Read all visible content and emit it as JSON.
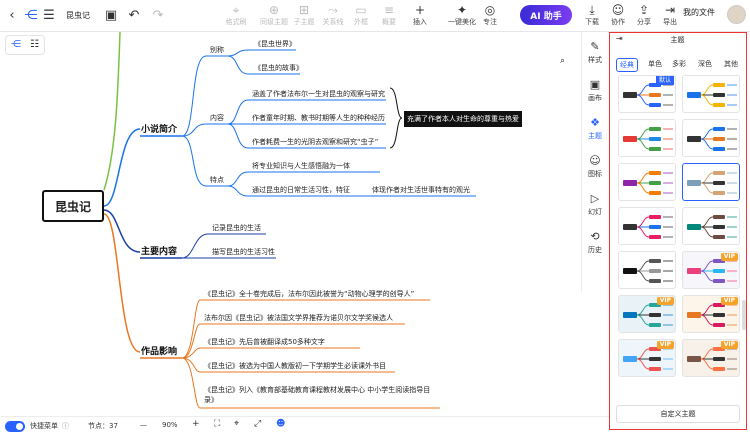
{
  "topbar": {
    "doc_title": "昆虫记",
    "tools": [
      {
        "glyph": "⌖",
        "label": "格式刷"
      },
      {
        "glyph": "⊕",
        "label": "同级主题"
      },
      {
        "glyph": "⊞",
        "label": "子主题"
      },
      {
        "glyph": "⤳",
        "label": "关系线"
      },
      {
        "glyph": "▭",
        "label": "外框"
      },
      {
        "glyph": "≡",
        "label": "概要"
      },
      {
        "glyph": "+",
        "label": "插入"
      },
      {
        "glyph": "✦",
        "label": "一键美化"
      },
      {
        "glyph": "◎",
        "label": "专注"
      }
    ],
    "ai_label": "AI 助手",
    "right_tools": [
      {
        "glyph": "⤓",
        "label": "下载"
      },
      {
        "glyph": "☺",
        "label": "协作"
      },
      {
        "glyph": "⇪",
        "label": "分享"
      },
      {
        "glyph": "⇥",
        "label": "导出"
      }
    ],
    "my_files": "我的文件"
  },
  "mindmap": {
    "root": "昆虫记",
    "branches": [
      {
        "title": "小说简介",
        "color": "#1a73e8",
        "groups": [
          {
            "label": "别称",
            "items": [
              "《昆虫世界》",
              "《昆虫的故事》"
            ]
          },
          {
            "label": "内容",
            "items": [
              "涵盖了作者法布尔一生对昆虫的观察与研究",
              "作者童年时期、教书时期等人生的种种经历",
              "作者耗费一生的光阴去观察和研究“虫子”"
            ]
          },
          {
            "label": "特点",
            "items": [
              "将专业知识与人生感悟融为一体",
              "通过昆虫的日常生活习性，特征"
            ]
          }
        ],
        "callout": "充满了作者本人对生命的尊重与热爱",
        "extra": "体现作者对生活世事特有的观光"
      },
      {
        "title": "主要内容",
        "color": "#1a3fa8",
        "items": [
          "记录昆虫的生活",
          "描写昆虫的生活习性"
        ]
      },
      {
        "title": "作品影响",
        "color": "#e87722",
        "items": [
          "《昆虫记》全十卷完成后，法布尔因此被誉为“动物心理学的创导人”",
          "法布尔因《昆虫记》被法国文学界推荐为诺贝尔文学奖候选人",
          "《昆虫记》先后曾被翻译成50多种文字",
          "《昆虫记》被选为中国人教版初一下学期学生必读课外书目",
          "《昆虫记》列入《教育部基础教育课程教材发展中心 中小学生阅读指导目",
          "录》"
        ]
      }
    ]
  },
  "rail": {
    "items": [
      {
        "glyph": "✎",
        "label": "样式"
      },
      {
        "glyph": "▣",
        "label": "画布"
      },
      {
        "glyph": "❖",
        "label": "主题"
      },
      {
        "glyph": "☺",
        "label": "图标"
      },
      {
        "glyph": "▷",
        "label": "幻灯"
      },
      {
        "glyph": "⟲",
        "label": "历史"
      }
    ]
  },
  "panel": {
    "title": "主题",
    "tabs": [
      "经典",
      "单色",
      "多彩",
      "深色",
      "其他"
    ],
    "default_badge": "默认",
    "vip_label": "VIP",
    "custom_button": "自定义主题"
  },
  "bottom": {
    "toggle_label": "快捷菜单",
    "node_count": "节点：37",
    "zoom_minus": "—",
    "zoom": "90%",
    "zoom_plus": "+"
  },
  "colors": {
    "accent": "#2962ff",
    "branch1": "#1a73e8",
    "branch2": "#1a3fa8",
    "branch3": "#e87722",
    "panel_border": "#e33333"
  }
}
